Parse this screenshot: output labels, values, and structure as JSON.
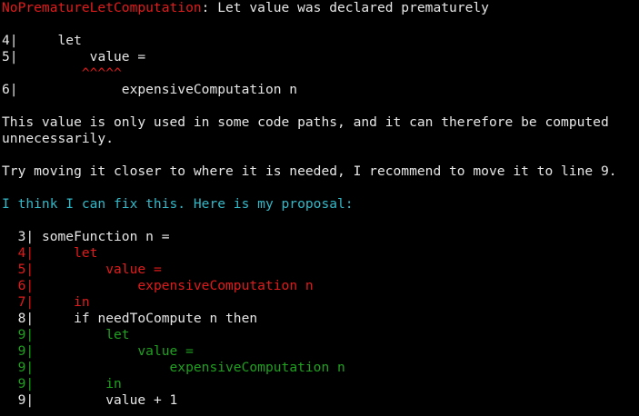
{
  "colors": {
    "background": "#000000",
    "text": "#e6e6e6",
    "error": "#e01b1b",
    "added": "#1fa01f",
    "info": "#33b8c8"
  },
  "error": {
    "name": "NoPrematureLetComputation",
    "message": ": Let value was declared prematurely"
  },
  "source_lines": [
    {
      "gutter": "4|",
      "code": "     let"
    },
    {
      "gutter": "5|",
      "code": "         value ="
    },
    {
      "gutter": "",
      "code": "          ^^^^^"
    },
    {
      "gutter": "6|",
      "code": "             expensiveComputation n"
    }
  ],
  "explanation": [
    "This value is only used in some code paths, and it can therefore be computed",
    "unnecessarily."
  ],
  "suggestion": "Try moving it closer to where it is needed, I recommend to move it to line 9.",
  "proposal_intro": "I think I can fix this. Here is my proposal:",
  "diff_lines": [
    {
      "gutter": "  3|",
      "code": " someFunction n =",
      "kind": "context"
    },
    {
      "gutter": "  4|",
      "code": "     let",
      "kind": "removed"
    },
    {
      "gutter": "  5|",
      "code": "         value =",
      "kind": "removed"
    },
    {
      "gutter": "  6|",
      "code": "             expensiveComputation n",
      "kind": "removed"
    },
    {
      "gutter": "  7|",
      "code": "     in",
      "kind": "removed"
    },
    {
      "gutter": "  8|",
      "code": "     if needToCompute n then",
      "kind": "context"
    },
    {
      "gutter": "  9|",
      "code": "         let",
      "kind": "added"
    },
    {
      "gutter": "  9|",
      "code": "             value =",
      "kind": "added"
    },
    {
      "gutter": "  9|",
      "code": "                 expensiveComputation n",
      "kind": "added"
    },
    {
      "gutter": "  9|",
      "code": "         in",
      "kind": "added"
    },
    {
      "gutter": "  9|",
      "code": "         value + 1",
      "kind": "context"
    }
  ]
}
